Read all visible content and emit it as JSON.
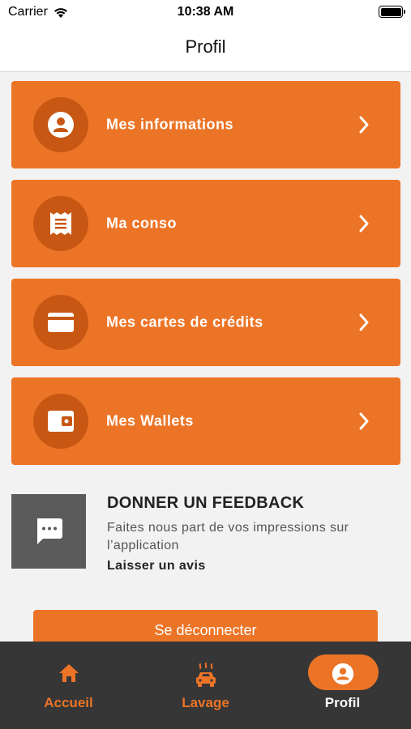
{
  "status_bar": {
    "carrier": "Carrier",
    "time": "10:38 AM"
  },
  "header": {
    "title": "Profil"
  },
  "menu": [
    {
      "label": "Mes informations",
      "icon": "user-icon"
    },
    {
      "label": "Ma conso",
      "icon": "receipt-icon"
    },
    {
      "label": "Mes cartes de crédits",
      "icon": "credit-card-icon"
    },
    {
      "label": "Mes Wallets",
      "icon": "wallet-icon"
    }
  ],
  "feedback": {
    "title": "DONNER UN FEEDBACK",
    "description": "Faites nous part de vos impressions sur l’application",
    "link": "Laisser un avis",
    "icon": "chat-icon"
  },
  "logout_label": "Se déconnecter",
  "tab_bar": {
    "tabs": [
      {
        "label": "Accueil",
        "icon": "home-icon",
        "active": false
      },
      {
        "label": "Lavage",
        "icon": "car-wash-icon",
        "active": false
      },
      {
        "label": "Profil",
        "icon": "user-icon",
        "active": true
      }
    ]
  },
  "colors": {
    "accent": "#ec7426",
    "accent_dark": "#c75713",
    "tab_bar_bg": "#363636",
    "feedback_box": "#5b5b5b"
  }
}
